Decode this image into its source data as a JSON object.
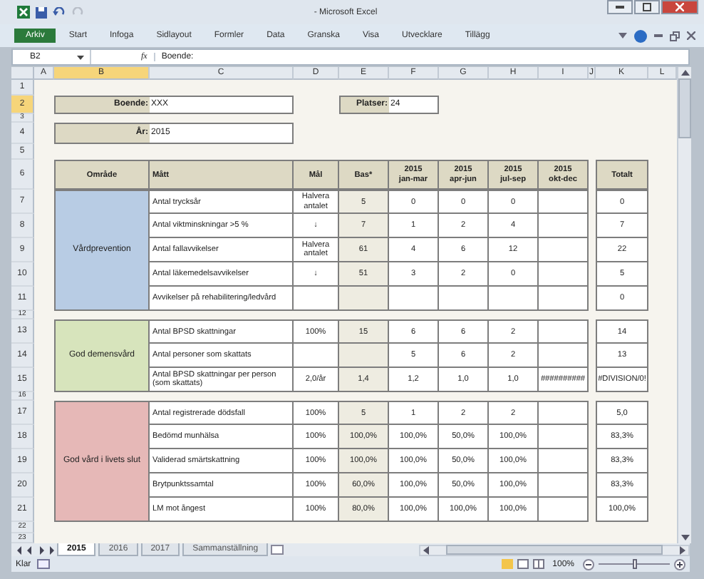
{
  "window": {
    "title": "- Microsoft Excel"
  },
  "file_tab": "Arkiv",
  "ribbon_tabs": [
    "Start",
    "Infoga",
    "Sidlayout",
    "Formler",
    "Data",
    "Granska",
    "Visa",
    "Utvecklare",
    "Tillägg"
  ],
  "formula_bar": {
    "name_box": "B2",
    "function_symbol": "fx",
    "formula": "Boende:"
  },
  "columns": [
    {
      "label": "A",
      "selected": false
    },
    {
      "label": "B",
      "selected": true
    },
    {
      "label": "C",
      "selected": false
    },
    {
      "label": "D",
      "selected": false
    },
    {
      "label": "E",
      "selected": false
    },
    {
      "label": "F",
      "selected": false
    },
    {
      "label": "G",
      "selected": false
    },
    {
      "label": "H",
      "selected": false
    },
    {
      "label": "I",
      "selected": false
    },
    {
      "label": "J",
      "selected": false
    },
    {
      "label": "K",
      "selected": false
    },
    {
      "label": "L",
      "selected": false
    }
  ],
  "row_numbers": [
    {
      "label": "1",
      "selected": false
    },
    {
      "label": "2",
      "selected": true
    },
    {
      "label": "3",
      "selected": false
    },
    {
      "label": "4",
      "selected": false
    },
    {
      "label": "5",
      "selected": false
    },
    {
      "label": "6",
      "selected": false
    },
    {
      "label": "7",
      "selected": false
    },
    {
      "label": "8",
      "selected": false
    },
    {
      "label": "9",
      "selected": false
    },
    {
      "label": "10",
      "selected": false
    },
    {
      "label": "11",
      "selected": false
    },
    {
      "label": "12",
      "selected": false
    },
    {
      "label": "13",
      "selected": false
    },
    {
      "label": "14",
      "selected": false
    },
    {
      "label": "15",
      "selected": false
    },
    {
      "label": "16",
      "selected": false
    },
    {
      "label": "17",
      "selected": false
    },
    {
      "label": "18",
      "selected": false
    },
    {
      "label": "19",
      "selected": false
    },
    {
      "label": "20",
      "selected": false
    },
    {
      "label": "21",
      "selected": false
    },
    {
      "label": "22",
      "selected": false
    },
    {
      "label": "23",
      "selected": false
    }
  ],
  "fields": [
    {
      "label": "Boende:",
      "value": "XXX"
    },
    {
      "label": "År:",
      "value": "2015"
    },
    {
      "label": "Platser:",
      "value": "24"
    }
  ],
  "table": {
    "headers": [
      "Område",
      "Mått",
      "Mål",
      "Bas*",
      "2015\njan-mar",
      "2015\napr-jun",
      "2015\njul-sep",
      "2015\nokt-dec"
    ],
    "total_header": "Totalt",
    "groups": [
      {
        "area": "Vårdprevention",
        "color": "#b8cce4",
        "rows": [
          {
            "measure": "Antal trycksår",
            "goal": "Halvera antalet",
            "base": "5",
            "quarters": [
              "0",
              "0",
              "0"
            ],
            "total": "0"
          },
          {
            "measure": "Antal viktminskningar >5 %",
            "goal": "↓",
            "base": "7",
            "quarters": [
              "1",
              "2",
              "4"
            ],
            "total": "7"
          },
          {
            "measure": "Antal fallavvikelser",
            "goal": "Halvera antalet",
            "base": "61",
            "quarters": [
              "4",
              "6",
              "12"
            ],
            "total": "22"
          },
          {
            "measure": "Antal läkemedelsavvikelser",
            "goal": "↓",
            "base": "51",
            "quarters": [
              "3",
              "2",
              "0"
            ],
            "total": "5"
          },
          {
            "measure": "Avvikelser på rehabilitering/ledvård",
            "quarters": [],
            "total": "0"
          }
        ]
      },
      {
        "area": "God demensvård",
        "color": "#d7e4bc",
        "rows": [
          {
            "measure": "Antal BPSD skattningar",
            "goal": "100%",
            "base": "15",
            "quarters": [
              "6",
              "6",
              "2"
            ],
            "total": "14"
          },
          {
            "measure": "Antal personer som skattats",
            "quarters": [
              "5",
              "6",
              "2"
            ],
            "total": "13"
          },
          {
            "measure": "Antal BPSD skattningar per person (som skattats)",
            "goal": "2,0/år",
            "base": "1,4",
            "quarters": [
              "1,2",
              "1,0",
              "1,0",
              "##########"
            ],
            "total": "#DIVISION/0!"
          }
        ]
      },
      {
        "area": "God vård i livets slut",
        "color": "#e6b8b7",
        "rows": [
          {
            "measure": "Antal registrerade dödsfall",
            "goal": "100%",
            "base": "5",
            "quarters": [
              "1",
              "2",
              "2"
            ],
            "total": "5,0"
          },
          {
            "measure": "Bedömd munhälsa",
            "goal": "100%",
            "base": "100,0%",
            "quarters": [
              "100,0%",
              "50,0%",
              "100,0%"
            ],
            "total": "83,3%"
          },
          {
            "measure": "Validerad smärtskattning",
            "goal": "100%",
            "base": "100,0%",
            "quarters": [
              "100,0%",
              "50,0%",
              "100,0%"
            ],
            "total": "83,3%"
          },
          {
            "measure": "Brytpunktssamtal",
            "goal": "100%",
            "base": "60,0%",
            "quarters": [
              "100,0%",
              "50,0%",
              "100,0%"
            ],
            "total": "83,3%"
          },
          {
            "measure": "LM mot ångest",
            "goal": "100%",
            "base": "80,0%",
            "quarters": [
              "100,0%",
              "100,0%",
              "100,0%"
            ],
            "total": "100,0%"
          }
        ]
      }
    ]
  },
  "sheet_tabs": [
    {
      "label": "2015",
      "selected": true
    },
    {
      "label": "2016",
      "selected": false
    },
    {
      "label": "2017",
      "selected": false
    },
    {
      "label": "Sammanställning",
      "selected": false
    }
  ],
  "status_bar": {
    "ready": "Klar",
    "zoom": "100%",
    "zoom_slider": {
      "level": 0.5
    }
  }
}
